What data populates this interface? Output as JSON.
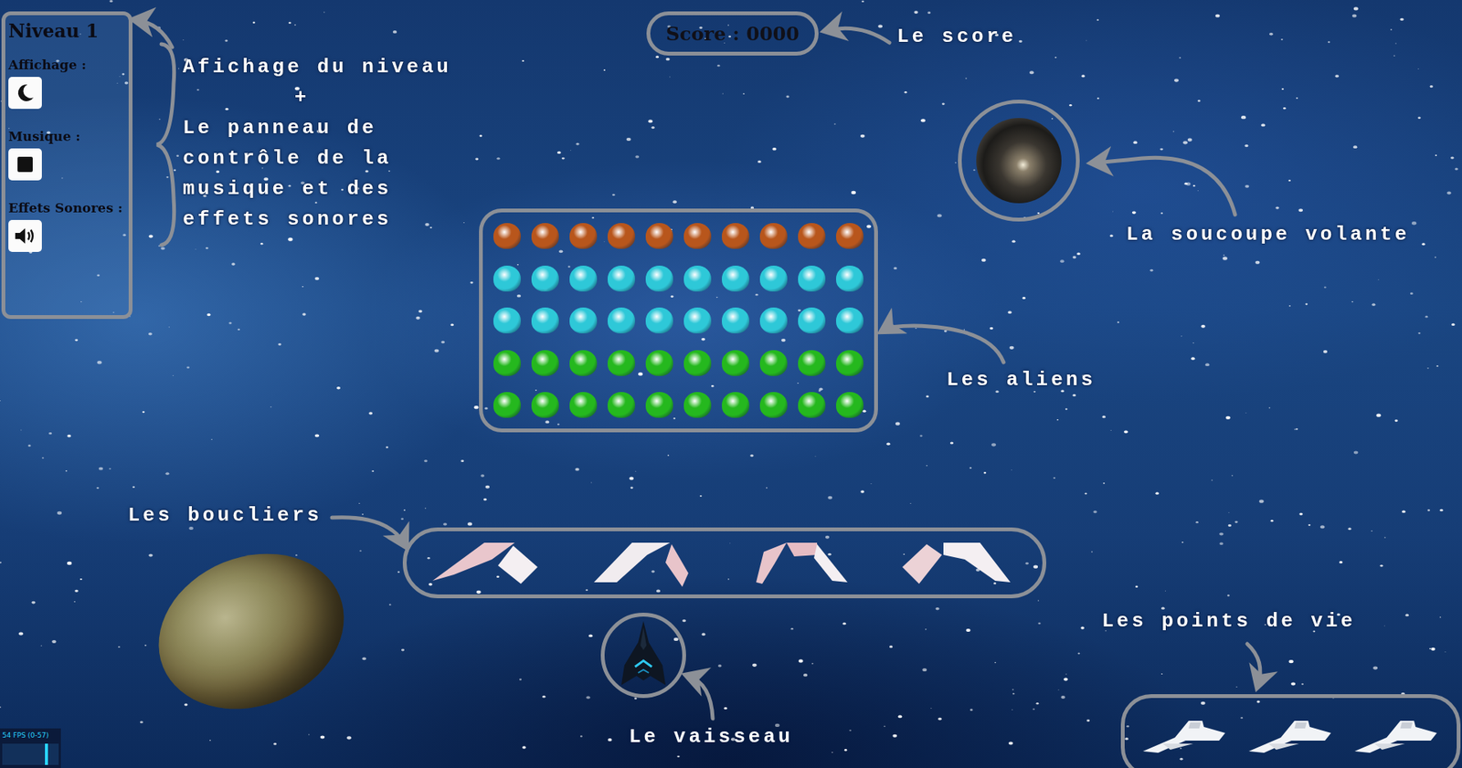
{
  "hud": {
    "level": "Niveau 1",
    "score": "Score : 0000",
    "fps": "54 FPS (0-57)"
  },
  "controls": [
    {
      "label": "Affichage :",
      "kind": "theme"
    },
    {
      "label": "Musique :",
      "kind": "music"
    },
    {
      "label": "Effets Sonores :",
      "kind": "sound"
    }
  ],
  "aliens": [
    {
      "color": "#b8561c",
      "count": 10
    },
    {
      "color": "#2ec8d8",
      "count": 10
    },
    {
      "color": "#2ec8d8",
      "count": 10
    },
    {
      "color": "#25b81e",
      "count": 10
    },
    {
      "color": "#25b81e",
      "count": 10
    }
  ],
  "shields": {
    "count": 4
  },
  "lives": {
    "count": 3
  },
  "annotations": {
    "panel": {
      "title": "Afichage du niveau",
      "joiner": "+",
      "lines": [
        "Le panneau de",
        "contrôle de la",
        "musique et des",
        "effets sonores"
      ]
    },
    "score": "Le score",
    "saucer": "La soucoupe volante",
    "aliens": "Les aliens",
    "shields": "Les boucliers",
    "ship": "Le vaisseau",
    "lives": "Les points de vie"
  }
}
